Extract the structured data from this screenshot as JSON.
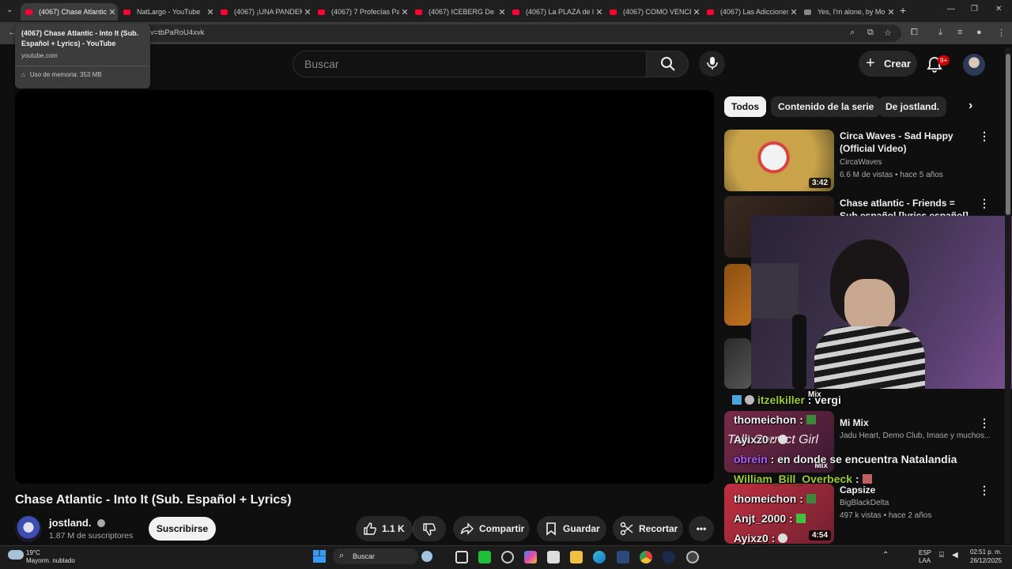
{
  "browser": {
    "tabs": [
      {
        "title": "(4067) Chase Atlantic - Into It",
        "active": true
      },
      {
        "title": "NatLargo - YouTube",
        "active": false
      },
      {
        "title": "(4067) ¡UNA PANDEMIA",
        "active": false
      },
      {
        "title": "(4067) 7 Profecías Para",
        "active": false
      },
      {
        "title": "(4067) ICEBERG De C",
        "active": false
      },
      {
        "title": "(4067) La PLAZA de l",
        "active": false
      },
      {
        "title": "(4067) COMO VENCE",
        "active": false
      },
      {
        "title": "(4067) Las Adicciones",
        "active": false
      },
      {
        "title": "Yes, I'm alone, by Mo",
        "active": false
      }
    ],
    "new_tab_symbol": "+",
    "url_fragment": "v=tbPaRoU4xvk",
    "tooltip": {
      "title": "(4067) Chase Atlantic - Into It (Sub. Español + Lyrics) - YouTube",
      "url": "youtube.com",
      "memory": "Uso de memoria: 353 MB"
    }
  },
  "header": {
    "search_placeholder": "Buscar",
    "create_label": "Crear",
    "notification_count": "9+"
  },
  "video": {
    "title": "Chase Atlantic - Into It (Sub. Español + Lyrics)",
    "channel": "jostland.",
    "subscribers": "1.87 M de suscriptores",
    "subscribe_label": "Suscribirse",
    "likes": "1.1 K",
    "share_label": "Compartir",
    "save_label": "Guardar",
    "clip_label": "Recortar"
  },
  "chips": [
    "Todos",
    "Contenido de la serie",
    "De jostland."
  ],
  "recommendations": [
    {
      "title": "Circa Waves - Sad Happy (Official Video)",
      "channel": "CircaWaves",
      "meta": "6.6 M de vistas • hace 5 años",
      "duration": "3:42"
    },
    {
      "title": "Chase atlantic - Friends = Sub español [lyrics español]",
      "channel": "",
      "meta": "",
      "duration": ""
    },
    {
      "title": "Mi Mix",
      "channel": "Jadu Heart, Demo Club, Imase y muchos...",
      "meta": "",
      "duration": "Mix"
    },
    {
      "title": "Capsize",
      "channel": "BigBlackDelta",
      "meta": "497 k vistas • hace 2 años",
      "duration": "4:54"
    }
  ],
  "mix_label_upper": "Mix",
  "thumb_overlay_text": "Talk Correct Girl",
  "chat": [
    {
      "user": "itzelkiller",
      "message": "vergi",
      "color": "#9acd32"
    },
    {
      "user": "thomeichon",
      "message": "",
      "color": "#f1f1f1"
    },
    {
      "user": "Ayixz0",
      "message": "",
      "color": "#f1f1f1"
    },
    {
      "user": "obrein",
      "message": "en donde se encuentra Natalandia",
      "color": "#b05cff"
    },
    {
      "user": "William_Bill_Overbeck",
      "message": "",
      "color": "#9acd32"
    },
    {
      "user": "thomeichon",
      "message": "",
      "color": "#f1f1f1"
    },
    {
      "user": "Anjt_2000",
      "message": "",
      "color": "#f1f1f1"
    },
    {
      "user": "Ayixz0",
      "message": "",
      "color": "#f1f1f1"
    }
  ],
  "taskbar": {
    "weather_temp": "19°C",
    "weather_desc": "Mayorm. nublado",
    "search_label": "Buscar",
    "lang1": "ESP",
    "lang2": "LAA",
    "time": "02:51 p. m.",
    "date": "26/12/2025"
  },
  "colors": {
    "youtube_red": "#ff0033",
    "accent_chip": "#f1f1f1",
    "bg": "#0f0f0f"
  }
}
